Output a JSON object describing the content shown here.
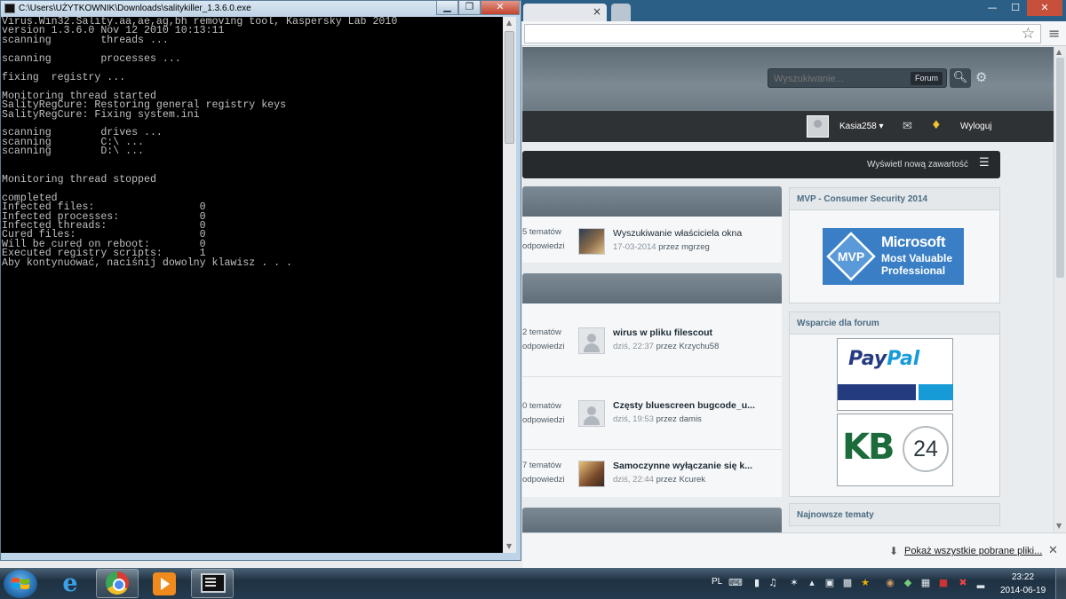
{
  "console": {
    "title": "C:\\Users\\UŻYTKOWNIK\\Downloads\\salitykiller_1.3.6.0.exe",
    "min_icon": "minimize-icon",
    "max_icon": "maximize-icon",
    "close_icon": "close-icon",
    "output": "Virus.Win32.Sality.aa,ae,ag,bh removing tool, Kaspersky Lab 2010\nversion 1.3.6.0 Nov 12 2010 10:13:11\nscanning        threads ...\n\nscanning        processes ...\n\nfixing  registry ...\n\nMonitoring thread started\nSalityRegCure: Restoring general registry keys\nSalityRegCure: Fixing system.ini\n\nscanning        drives ...\nscanning        C:\\ ...\nscanning        D:\\ ...\n\n\nMonitoring thread stopped\n\ncompleted\nInfected files:                 0\nInfected processes:             0\nInfected threads:               0\nCured files:                    0\nWill be cured on reboot:        0\nExecuted registry scripts:      1\nAby kontynuować, naciśnij dowolny klawisz . . ."
  },
  "browser": {
    "tab_close": "×",
    "window_controls": {
      "minimize": "—",
      "maximize": "☐",
      "close": "✕"
    },
    "star_icon": "☆",
    "menu_icon": "≡"
  },
  "forum": {
    "search": {
      "placeholder": "Wyszukiwanie...",
      "scope": "Forum"
    },
    "user": {
      "name": "Kasia258",
      "logout": "Wyloguj"
    },
    "view_new_content": "Wyświetl nową zawartość",
    "topics": [
      {
        "stat_topics": "5 tematów",
        "stat_replies": "odpowiedzi",
        "title": "Wyszukiwanie właściciela okna",
        "date": "17-03-2014",
        "by": "przez mgrzeg",
        "avatar": "photo",
        "bold": false
      },
      {
        "stat_topics": "2 tematów",
        "stat_replies": "odpowiedzi",
        "title": "wirus w pliku filescout",
        "date": "dziś, 22:37",
        "by": "przez Krzychu58",
        "avatar": "generic",
        "bold": true
      },
      {
        "stat_topics": "0 tematów",
        "stat_replies": "odpowiedzi",
        "title": "Częsty bluescreen bugcode_u...",
        "date": "dziś, 19:53",
        "by": "przez damis",
        "avatar": "generic",
        "bold": true
      },
      {
        "stat_topics": "7 tematów",
        "stat_replies": "odpowiedzi",
        "title": "Samoczynne wyłączanie się k...",
        "date": "dziś, 22:44",
        "by": "przez Kcurek",
        "avatar": "cat",
        "bold": true
      }
    ],
    "sidebar": {
      "mvp_title": "MVP - Consumer Security 2014",
      "mvp_logo": {
        "line1": "Microsoft",
        "line2": "Most Valuable Professional",
        "shield": "MVP"
      },
      "support_title": "Wsparcie dla forum",
      "paypal": {
        "part1": "Pay",
        "part2": "Pal"
      },
      "kb24": {
        "kb": "KB",
        "num": "24"
      },
      "latest_title": "Najnowsze tematy"
    }
  },
  "downloads": {
    "show_all": "Pokaż wszystkie pobrane pliki...",
    "close": "✕"
  },
  "taskbar": {
    "lang": "PL",
    "clock_time": "23:22",
    "clock_date": "2014-06-19"
  }
}
